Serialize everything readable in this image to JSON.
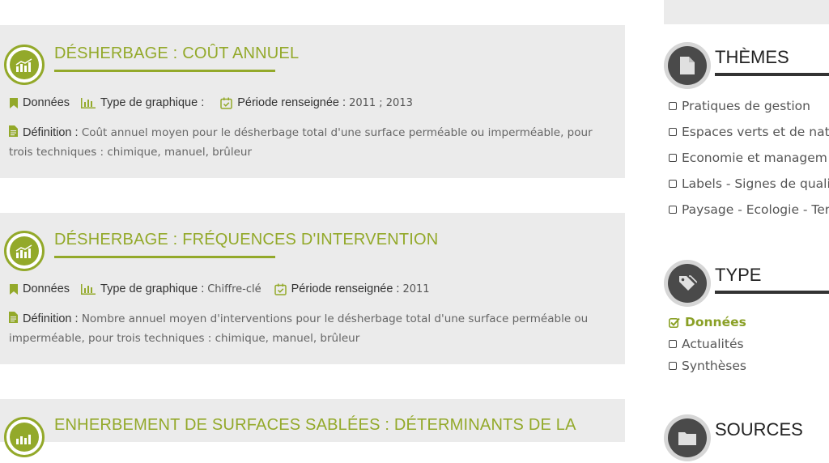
{
  "results": [
    {
      "title": "DÉSHERBAGE : COÛT ANNUEL",
      "type_label": "Données",
      "graph_label": "Type de graphique :",
      "graph_value": "",
      "period_label": "Période renseignée :",
      "period_value": "2011 ; 2013",
      "def_label": "Définition :",
      "def_line1": "Coût annuel moyen pour le désherbage total d'une surface perméable ou imperméable, pour",
      "def_line2": "trois techniques : chimique, manuel, brûleur"
    },
    {
      "title": "DÉSHERBAGE : FRÉQUENCES D'INTERVENTION",
      "type_label": "Données",
      "graph_label": "Type de graphique :",
      "graph_value": "Chiffre-clé",
      "period_label": "Période renseignée :",
      "period_value": "2011",
      "def_label": "Définition :",
      "def_line1": "Nombre annuel moyen d'interventions pour le désherbage total d'une surface perméable ou",
      "def_line2": "imperméable, pour trois techniques : chimique, manuel, brûleur"
    },
    {
      "title": "ENHERBEMENT DE SURFACES SABLÉES : DÉTERMINANTS DE LA"
    }
  ],
  "sidebar": {
    "themes": {
      "title": "THÈMES",
      "icon": "document-icon",
      "options": [
        "Pratiques de gestion",
        "Espaces verts et de nat",
        "Economie et managem",
        "Labels - Signes de quali",
        "Paysage - Ecologie - Ter"
      ]
    },
    "type": {
      "title": "TYPE",
      "icon": "tags-icon",
      "options": [
        {
          "label": "Données",
          "checked": true
        },
        {
          "label": "Actualités",
          "checked": false
        },
        {
          "label": "Synthèses",
          "checked": false
        }
      ]
    },
    "sources": {
      "title": "SOURCES",
      "icon": "folder-icon"
    }
  },
  "colors": {
    "accent": "#93a92a",
    "card_bg": "#ebebeb",
    "dark": "#333333"
  }
}
